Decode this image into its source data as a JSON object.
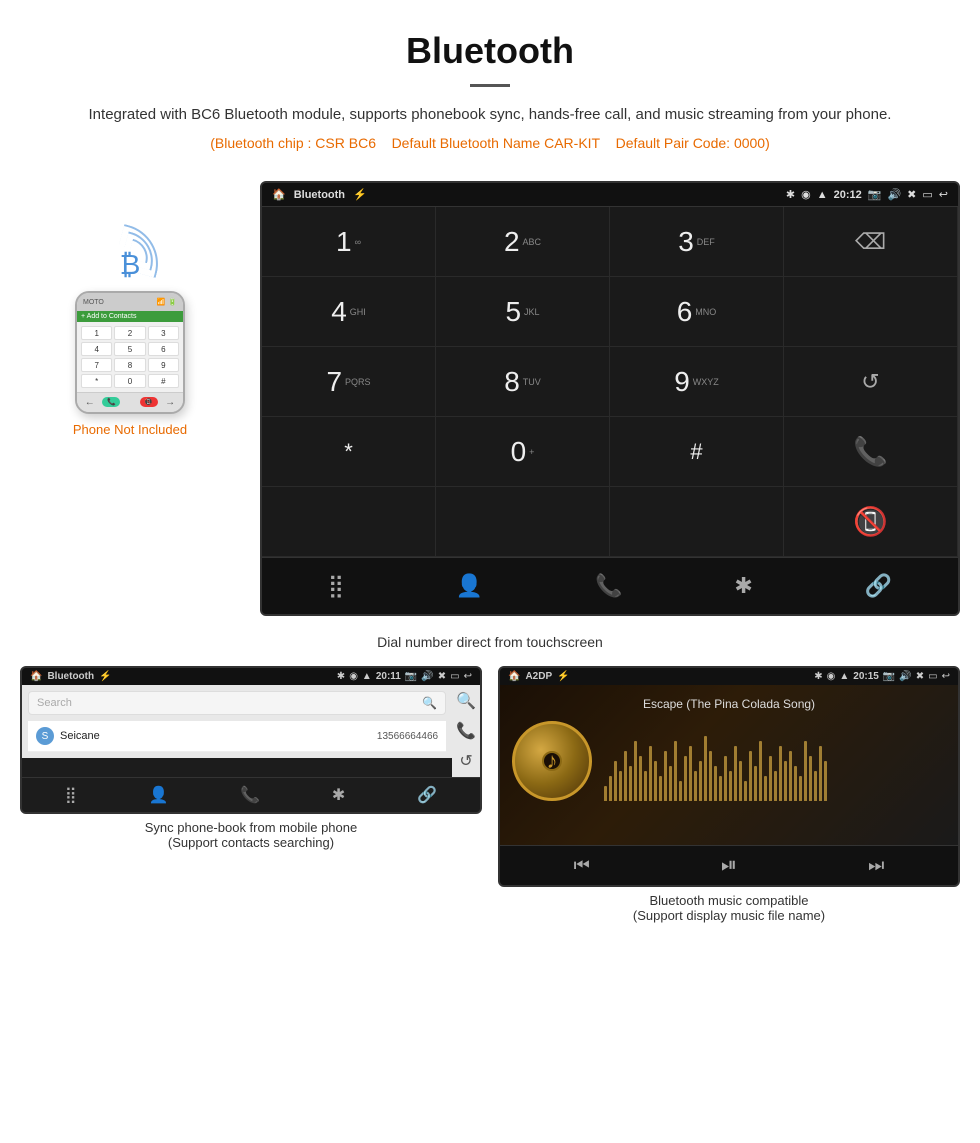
{
  "header": {
    "title": "Bluetooth",
    "description": "Integrated with BC6 Bluetooth module, supports phonebook sync, hands-free call, and music streaming from your phone.",
    "specs": "(Bluetooth chip : CSR BC6    Default Bluetooth Name CAR-KIT    Default Pair Code: 0000)",
    "specs_parts": {
      "chip": "(Bluetooth chip : CSR BC6",
      "name": "Default Bluetooth Name CAR-KIT",
      "code": "Default Pair Code: 0000)"
    }
  },
  "phone_label": {
    "not": "Phone Not",
    "included": "Included"
  },
  "car_screen": {
    "status_bar": {
      "left": [
        "🏠",
        "Bluetooth",
        "⚡"
      ],
      "center": "",
      "time": "20:12",
      "right_icons": [
        "📷",
        "🔊",
        "✖",
        "▭",
        "↩"
      ]
    },
    "dialpad": [
      {
        "num": "1",
        "sub": "∞"
      },
      {
        "num": "2",
        "sub": "ABC"
      },
      {
        "num": "3",
        "sub": "DEF"
      },
      {
        "num": "",
        "sub": "",
        "type": "backspace"
      },
      {
        "num": "4",
        "sub": "GHI"
      },
      {
        "num": "5",
        "sub": "JKL"
      },
      {
        "num": "6",
        "sub": "MNO"
      },
      {
        "num": "",
        "sub": "",
        "type": "empty"
      },
      {
        "num": "7",
        "sub": "PQRS"
      },
      {
        "num": "8",
        "sub": "TUV"
      },
      {
        "num": "9",
        "sub": "WXYZ"
      },
      {
        "num": "",
        "sub": "",
        "type": "redial"
      },
      {
        "num": "*",
        "sub": ""
      },
      {
        "num": "0",
        "sub": "+"
      },
      {
        "num": "#",
        "sub": ""
      },
      {
        "num": "",
        "sub": "",
        "type": "call-green"
      },
      {
        "num": "",
        "sub": "",
        "type": "empty2"
      },
      {
        "num": "",
        "sub": "",
        "type": "empty3"
      },
      {
        "num": "",
        "sub": "",
        "type": "empty4"
      },
      {
        "num": "",
        "sub": "",
        "type": "call-red"
      }
    ],
    "nav_icons": [
      "⣿",
      "👤",
      "📞",
      "✱",
      "🔗"
    ]
  },
  "caption": "Dial number direct from touchscreen",
  "phonebook_screen": {
    "status_left": [
      "🏠",
      "Bluetooth",
      "⚡"
    ],
    "status_time": "20:11",
    "search_placeholder": "Search",
    "contacts": [
      {
        "letter": "S",
        "name": "Seicane",
        "number": "13566664466"
      }
    ],
    "nav_icons": [
      "⣿",
      "👤",
      "📞",
      "✱",
      "🔗"
    ],
    "active_nav": 1
  },
  "phonebook_caption_line1": "Sync phone-book from mobile phone",
  "phonebook_caption_line2": "(Support contacts searching)",
  "music_screen": {
    "status_left": [
      "🏠",
      "A2DP",
      "⚡"
    ],
    "status_time": "20:15",
    "song_title": "Escape (The Pina Colada Song)",
    "nav_icons": [
      "⏮",
      "⏯",
      "⏭"
    ]
  },
  "music_caption_line1": "Bluetooth music compatible",
  "music_caption_line2": "(Support display music file name)",
  "visualizer_heights": [
    15,
    25,
    40,
    30,
    50,
    35,
    60,
    45,
    30,
    55,
    40,
    25,
    50,
    35,
    60,
    20,
    45,
    55,
    30,
    40,
    65,
    50,
    35,
    25,
    45,
    30,
    55,
    40,
    20,
    50,
    35,
    60,
    25,
    45,
    30,
    55,
    40,
    50,
    35,
    25,
    60,
    45,
    30,
    55,
    40
  ]
}
